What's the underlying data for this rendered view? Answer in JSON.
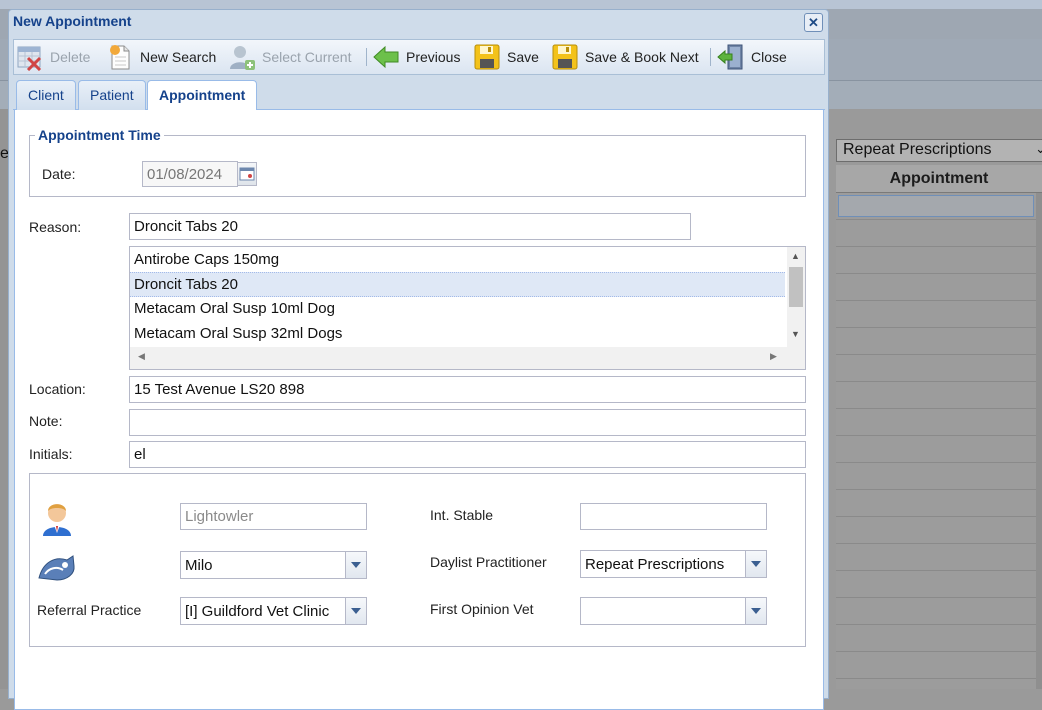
{
  "dialog": {
    "title": "New Appointment",
    "close_glyph": "✕"
  },
  "toolbar": {
    "delete": "Delete",
    "new_search": "New Search",
    "select_current": "Select Current",
    "previous": "Previous",
    "save": "Save",
    "save_book_next": "Save & Book Next",
    "close": "Close"
  },
  "tabs": [
    {
      "label": "Client"
    },
    {
      "label": "Patient"
    },
    {
      "label": "Appointment"
    }
  ],
  "appointment_time": {
    "legend": "Appointment Time",
    "date_label": "Date:",
    "date_value": "01/08/2024"
  },
  "form": {
    "reason_label": "Reason:",
    "reason_value": "Droncit Tabs 20",
    "reason_options": [
      "Antirobe Caps 150mg",
      "Droncit Tabs 20",
      "Metacam Oral Susp 10ml Dog",
      "Metacam Oral Susp 32ml Dogs"
    ],
    "location_label": "Location:",
    "location_value": "15 Test Avenue LS20 898",
    "note_label": "Note:",
    "note_value": "",
    "initials_label": "Initials:",
    "initials_value": "el"
  },
  "details": {
    "client_value": "Lightowler",
    "patient_value": "Milo",
    "referral_label": "Referral Practice",
    "referral_value": "[I] Guildford Vet Clinic",
    "int_stable_label": "Int. Stable",
    "int_stable_value": "",
    "daylist_label": "Daylist Practitioner",
    "daylist_value": "Repeat Prescriptions",
    "first_opinion_label": "First Opinion Vet",
    "first_opinion_value": ""
  },
  "background": {
    "practitioner_select": "Repeat Prescriptions",
    "column_header": "Appointment",
    "left_edge_char": "e"
  },
  "icons": {
    "delete": "calendar-delete-icon",
    "new_search": "new-document-icon",
    "select_current": "user-add-icon",
    "previous": "green-arrow-left-icon",
    "save": "floppy-disk-icon",
    "save_book_next": "floppy-disk-icon",
    "close": "exit-door-icon",
    "client": "person-icon",
    "patient": "pet-icon"
  }
}
